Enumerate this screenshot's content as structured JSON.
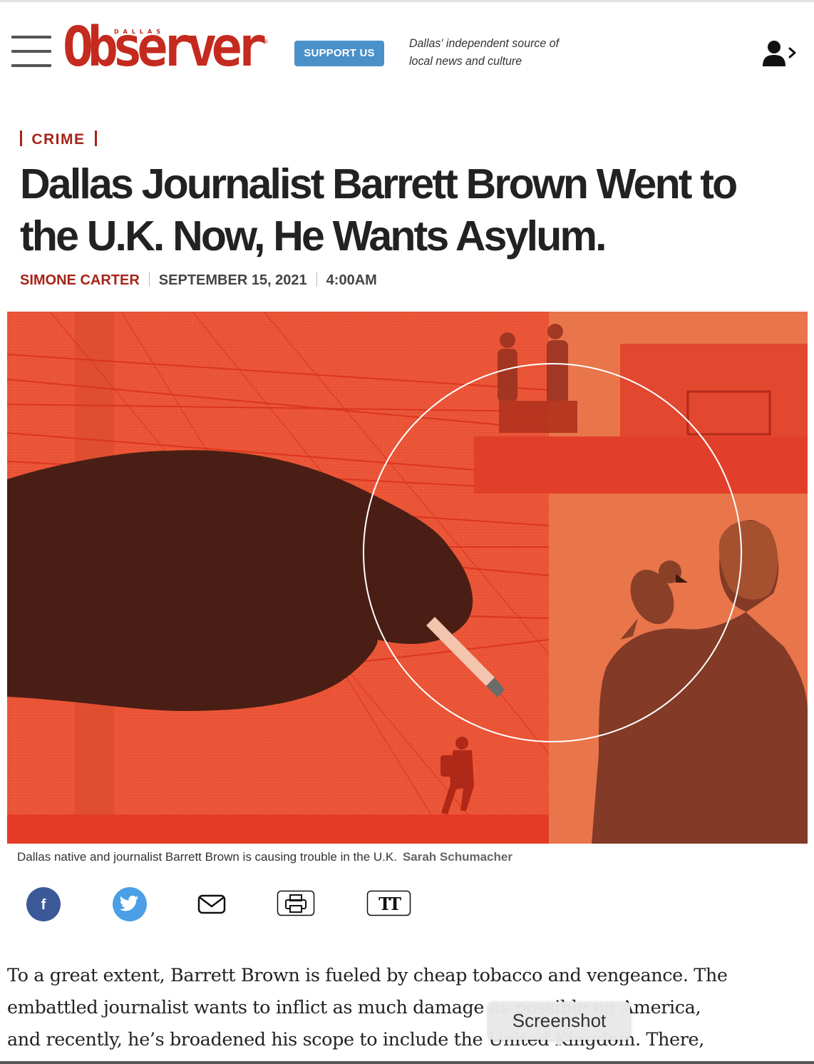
{
  "header": {
    "logo_small_text": "DALLAS",
    "logo_text": "Observer",
    "support_label": "SUPPORT US",
    "tagline_line1": "Dallas' independent source of",
    "tagline_line2": "local news and culture"
  },
  "article": {
    "section": "CRIME",
    "headline_line1": "Dallas Journalist Barrett Brown Went to",
    "headline_line2": "the U.K. Now, He Wants Asylum.",
    "author": "SIMONE CARTER",
    "date": "SEPTEMBER 15, 2021",
    "time": "4:00AM",
    "caption": "Dallas native and journalist Barrett Brown is causing trouble in the U.K.",
    "credit": "Sarah Schumacher",
    "body_lines": [
      "To a great extent, Barrett Brown is fueled by cheap tobacco and vengeance. The",
      "embattled journalist wants to inflict as much damage as possible on America,",
      "and recently, he’s broadened his scope to include the United Kingdom. There,"
    ]
  },
  "share": {
    "facebook_glyph": "f",
    "text_size_glyph": "TT"
  },
  "icons": {
    "menu": "hamburger-menu-icon",
    "user": "user-account-icon",
    "facebook": "facebook-icon",
    "twitter": "twitter-icon",
    "email": "envelope-icon",
    "print": "printer-icon",
    "text_size": "text-size-icon"
  },
  "tooltip": {
    "label": "Screenshot"
  },
  "colors": {
    "brand_red": "#c52a1f",
    "support_blue": "#4a90c9",
    "facebook_blue": "#3b5998",
    "twitter_blue": "#4a9fe6",
    "hero_orange": "#e9754a",
    "hero_red": "#e8412c"
  }
}
